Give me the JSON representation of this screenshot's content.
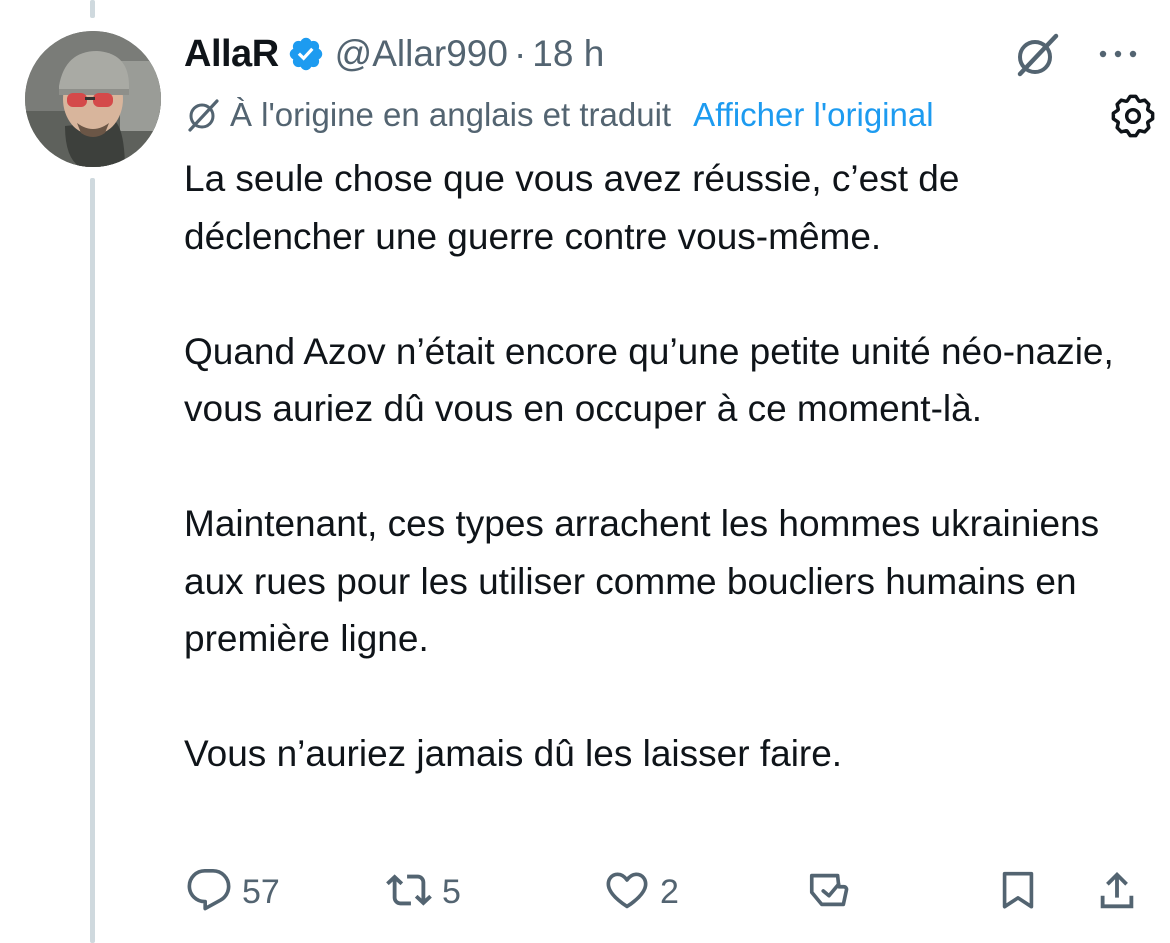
{
  "tweet": {
    "author_name": "AllaR",
    "handle": "@Allar990",
    "separator": "·",
    "time": "18 h",
    "translation_note": "À l'origine en anglais et traduit",
    "show_original_label": "Afficher l'original",
    "paragraphs": [
      "La seule chose que vous avez réussie, c’est de déclencher une guerre contre vous-même.",
      "Quand Azov n’était encore qu’une petite unité néo-nazie, vous auriez dû vous en occuper à ce moment-là.",
      "Maintenant, ces types arrachent les hommes ukrainiens aux rues pour les utiliser comme boucliers humains en première ligne.",
      "Vous n’auriez jamais dû les laisser faire."
    ]
  },
  "actions": {
    "reply_count": "57",
    "retweet_count": "5",
    "like_count": "2"
  },
  "icons": {
    "verified": "verified-badge-icon",
    "grok": "grok-icon",
    "more": "more-options-icon",
    "translated": "translated-icon",
    "settings": "settings-gear-icon",
    "reply": "reply-icon",
    "retweet": "retweet-icon",
    "like": "heart-icon",
    "grok_action": "grok-explain-icon",
    "bookmark": "bookmark-icon",
    "share": "share-icon"
  },
  "colors": {
    "text": "#0f1419",
    "secondary": "#536471",
    "accent": "#1d9bf0",
    "thread_line": "#cfd9de"
  }
}
